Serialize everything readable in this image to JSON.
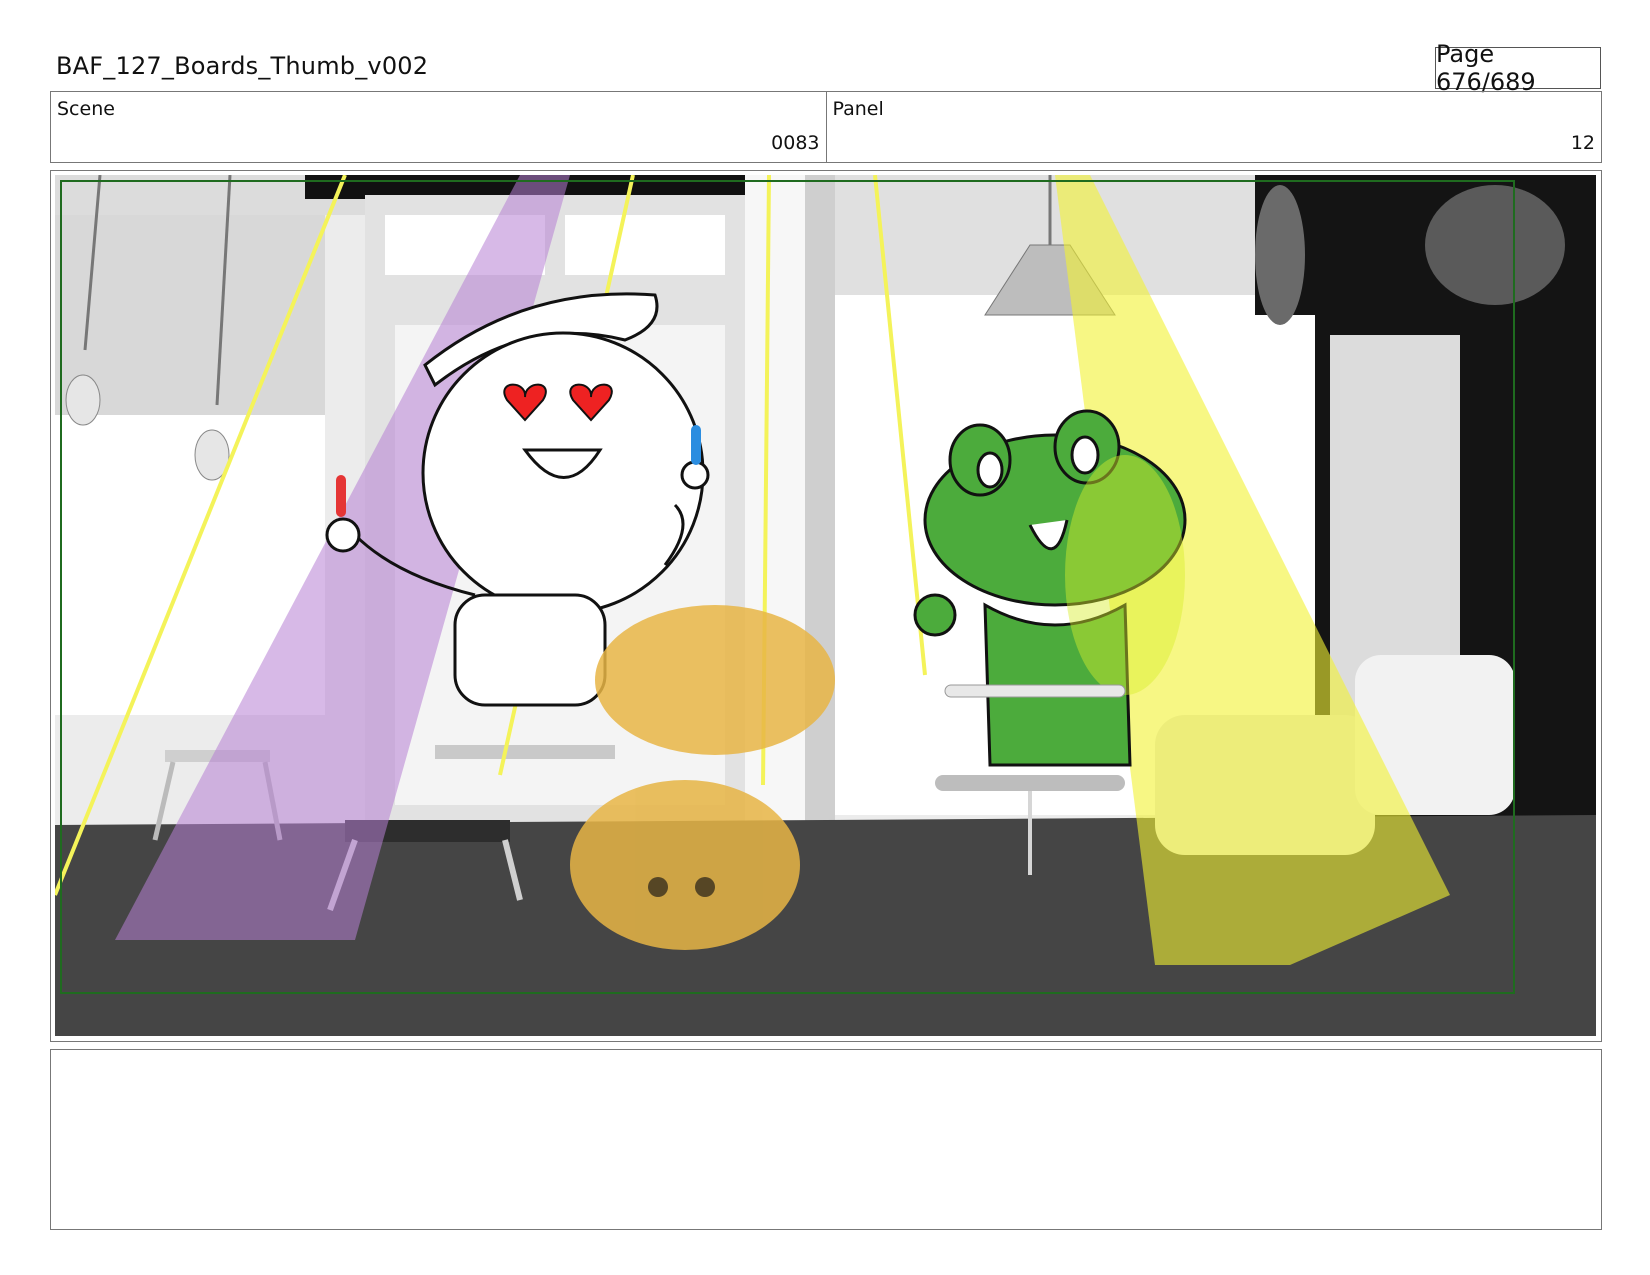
{
  "header": {
    "title": "BAF_127_Boards_Thumb_v002",
    "page": "Page 676/689"
  },
  "meta": {
    "scene_label": "Scene",
    "scene_value": "0083",
    "panel_label": "Panel",
    "panel_value": "12"
  },
  "panel_image": {
    "content": [
      "white-character-with-heart-eyes",
      "green-frog-character",
      "blurred-orange-figure",
      "purple-spotlight",
      "yellow-spotlight",
      "cafe-interior"
    ]
  },
  "notes": {
    "text": ""
  }
}
